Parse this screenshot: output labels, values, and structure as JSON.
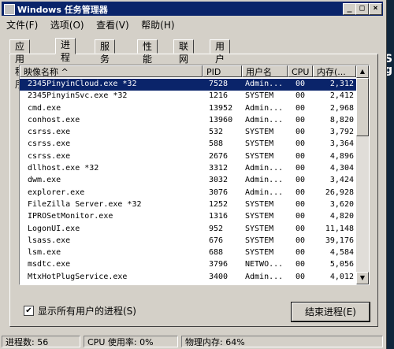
{
  "window": {
    "title": "Windows 任务管理器",
    "min": "_",
    "max": "□",
    "close": "×"
  },
  "menu": [
    "文件(F)",
    "选项(O)",
    "查看(V)",
    "帮助(H)"
  ],
  "tabs": [
    "应用程序",
    "进程",
    "服务",
    "性能",
    "联网",
    "用户"
  ],
  "active_tab": "进程",
  "columns": [
    "映像名称  ^",
    "PID",
    "用户名",
    "CPU",
    "内存(..."
  ],
  "processes": [
    {
      "name": "2345PinyinCloud.exe *32",
      "pid": "7528",
      "user": "Admin...",
      "cpu": "00",
      "mem": "2,312"
    },
    {
      "name": "2345PinyinSvc.exe *32",
      "pid": "1216",
      "user": "SYSTEM",
      "cpu": "00",
      "mem": "2,412"
    },
    {
      "name": "cmd.exe",
      "pid": "13952",
      "user": "Admin...",
      "cpu": "00",
      "mem": "2,968"
    },
    {
      "name": "conhost.exe",
      "pid": "13960",
      "user": "Admin...",
      "cpu": "00",
      "mem": "8,820"
    },
    {
      "name": "csrss.exe",
      "pid": "532",
      "user": "SYSTEM",
      "cpu": "00",
      "mem": "3,792"
    },
    {
      "name": "csrss.exe",
      "pid": "588",
      "user": "SYSTEM",
      "cpu": "00",
      "mem": "3,364"
    },
    {
      "name": "csrss.exe",
      "pid": "2676",
      "user": "SYSTEM",
      "cpu": "00",
      "mem": "4,896"
    },
    {
      "name": "dllhost.exe *32",
      "pid": "3312",
      "user": "Admin...",
      "cpu": "00",
      "mem": "4,304"
    },
    {
      "name": "dwm.exe",
      "pid": "3032",
      "user": "Admin...",
      "cpu": "00",
      "mem": "3,424"
    },
    {
      "name": "explorer.exe",
      "pid": "3076",
      "user": "Admin...",
      "cpu": "00",
      "mem": "26,928"
    },
    {
      "name": "FileZilla Server.exe *32",
      "pid": "1252",
      "user": "SYSTEM",
      "cpu": "00",
      "mem": "3,620"
    },
    {
      "name": "IPROSetMonitor.exe",
      "pid": "1316",
      "user": "SYSTEM",
      "cpu": "00",
      "mem": "4,820"
    },
    {
      "name": "LogonUI.exe",
      "pid": "952",
      "user": "SYSTEM",
      "cpu": "00",
      "mem": "11,148"
    },
    {
      "name": "lsass.exe",
      "pid": "676",
      "user": "SYSTEM",
      "cpu": "00",
      "mem": "39,176"
    },
    {
      "name": "lsm.exe",
      "pid": "688",
      "user": "SYSTEM",
      "cpu": "00",
      "mem": "4,584"
    },
    {
      "name": "msdtc.exe",
      "pid": "3796",
      "user": "NETWO...",
      "cpu": "00",
      "mem": "5,056"
    },
    {
      "name": "MtxHotPlugService.exe",
      "pid": "3400",
      "user": "Admin...",
      "cpu": "00",
      "mem": "4,012"
    }
  ],
  "selected_index": 0,
  "show_all_users": {
    "label": "显示所有用户的进程(S)",
    "checked": true,
    "mark": "✔"
  },
  "end_process_button": "结束进程(E)",
  "status": {
    "processes": "进程数: 56",
    "cpu": "CPU 使用率: 0%",
    "memory": "物理内存: 64%"
  },
  "scroll": {
    "up": "▲",
    "down": "▼"
  },
  "accent_color": "#0a246a"
}
